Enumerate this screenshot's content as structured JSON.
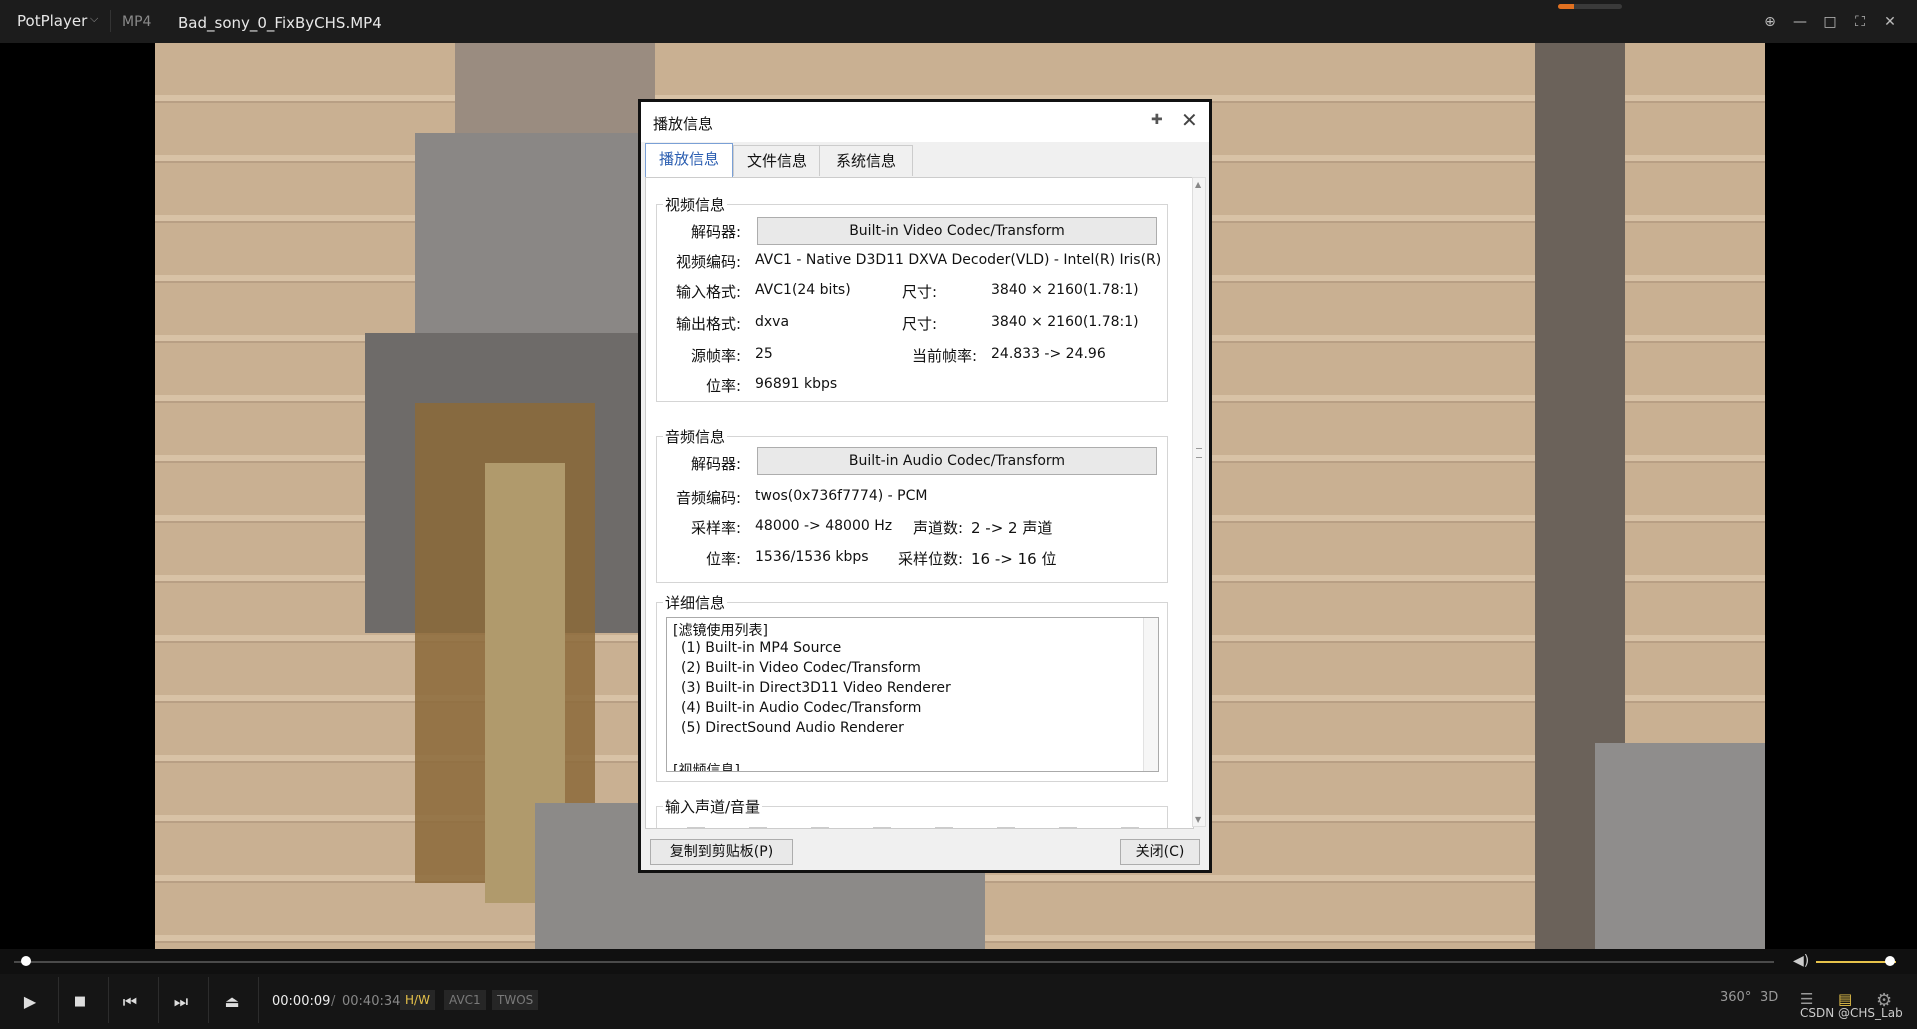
{
  "titlebar": {
    "app_name": "PotPlayer",
    "caret": "⌵",
    "format": "MP4",
    "filename": "Bad_sony_0_FixByCHS.MP4",
    "mini_bar_fill": 0.25
  },
  "window_controls": {
    "pin": "⊕",
    "minimize": "—",
    "maximize": "□",
    "fullscreen": "⛶",
    "close": "✕"
  },
  "dialog": {
    "title": "播放信息",
    "pin": "✚",
    "close": "✕",
    "tabs": [
      {
        "label": "播放信息"
      },
      {
        "label": "文件信息"
      },
      {
        "label": "系统信息"
      }
    ],
    "video": {
      "group_label": "视频信息",
      "decoder_label": "解码器:",
      "decoder_button": "Built-in Video Codec/Transform",
      "codec_label": "视频编码:",
      "codec_value": "AVC1 - Native D3D11 DXVA Decoder(VLD) - Intel(R) Iris(R) Xe",
      "input_label": "输入格式:",
      "input_value": "AVC1(24 bits)",
      "input_size_label": "尺寸:",
      "input_size_value": "3840 × 2160(1.78:1)",
      "output_label": "输出格式:",
      "output_value": "dxva",
      "output_size_label": "尺寸:",
      "output_size_value": "3840 × 2160(1.78:1)",
      "fps_label": "源帧率:",
      "fps_value": "25",
      "cur_fps_label": "当前帧率:",
      "cur_fps_value": "24.833 -> 24.96",
      "bitrate_label": "位率:",
      "bitrate_value": "96891 kbps"
    },
    "audio": {
      "group_label": "音频信息",
      "decoder_label": "解码器:",
      "decoder_button": "Built-in Audio Codec/Transform",
      "codec_label": "音频编码:",
      "codec_value": "twos(0x736f7774) - PCM",
      "rate_label": "采样率:",
      "rate_value": "48000 -> 48000 Hz",
      "channels_label": "声道数:",
      "channels_value": "2 -> 2 声道",
      "bitrate_label": "位率:",
      "bitrate_value": "1536/1536 kbps",
      "bits_label": "采样位数:",
      "bits_value": "16 -> 16 位"
    },
    "detail": {
      "group_label": "详细信息",
      "lines": [
        "[滤镜使用列表]",
        "  (1) Built-in MP4 Source",
        "  (2) Built-in Video Codec/Transform",
        "  (3) Built-in Direct3D11 Video Renderer",
        "  (4) Built-in Audio Codec/Transform",
        "  (5) DirectSound Audio Renderer",
        "",
        "[视频信息]"
      ]
    },
    "channel_group_label": "输入声道/音量",
    "copy_button": "复制到剪贴板(P)",
    "close_button": "关闭(C)"
  },
  "player": {
    "play": "▶",
    "stop": "■",
    "prev": "⏮",
    "next": "⏭",
    "eject": "⏏",
    "time_current": "00:00:09",
    "time_sep": "/",
    "time_total": "00:40:34",
    "badges": [
      "H/W",
      "AVC1",
      "TWOS"
    ],
    "right_icons": {
      "vr": "360°",
      "threed": "3D",
      "playlist": "☰",
      "chat": "▤",
      "settings": "⚙"
    },
    "volume_icon": "◀)",
    "seek_progress": 0.0037,
    "volume_level": 0.93
  },
  "colors": {
    "accent": "#e6c24a",
    "hw_badge": "#e6c24a",
    "active_tab": "#2a5db0"
  },
  "watermark": "CSDN @CHS_Lab"
}
